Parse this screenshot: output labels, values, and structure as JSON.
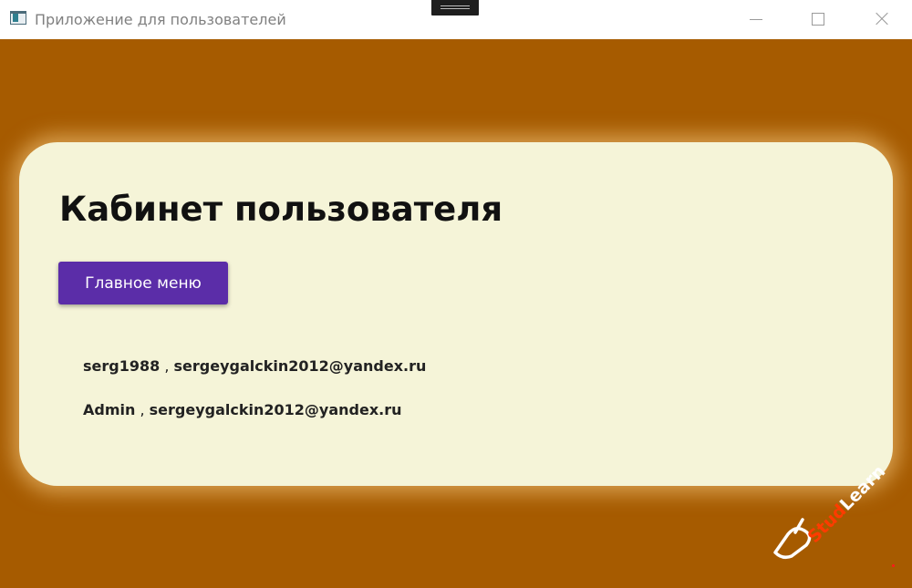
{
  "window": {
    "title": "Приложение для пользователей"
  },
  "page": {
    "title": "Кабинет пользователя",
    "main_menu_label": "Главное меню"
  },
  "users": [
    {
      "login": "serg1988",
      "separator": " , ",
      "email": "sergeygalckin2012@yandex.ru"
    },
    {
      "login": "Admin",
      "separator": " , ",
      "email": "sergeygalckin2012@yandex.ru"
    }
  ],
  "watermark": {
    "part1": "Stud",
    "part2": "Learn"
  },
  "colors": {
    "background": "#a65b00",
    "card": "#f5f4d8",
    "button": "#5b2da8"
  },
  "icons": {
    "app": "app-window-icon",
    "minimize": "minimize-icon",
    "maximize": "maximize-icon",
    "close": "close-icon",
    "watermark": "pen-logo-icon"
  }
}
